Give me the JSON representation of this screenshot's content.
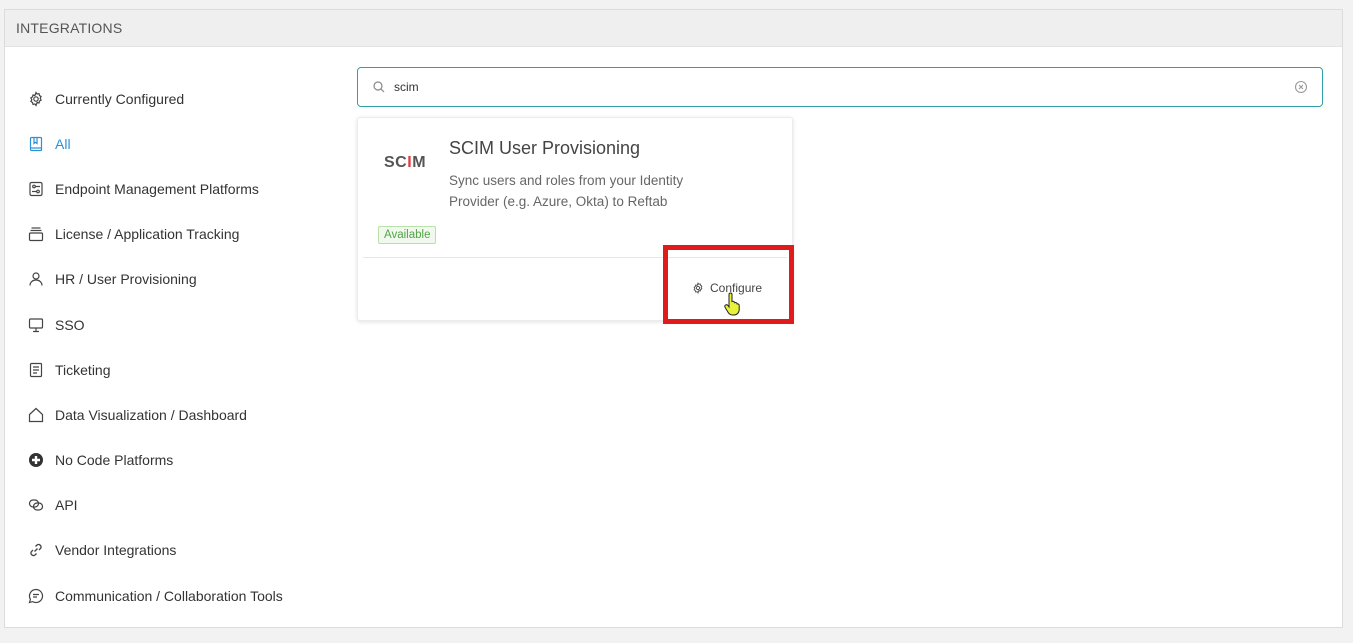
{
  "header": {
    "title": "INTEGRATIONS"
  },
  "sidebar": {
    "items": [
      {
        "label": "Currently Configured",
        "icon": "gear-icon"
      },
      {
        "label": "All",
        "icon": "book-icon",
        "active": true
      },
      {
        "label": "Endpoint Management Platforms",
        "icon": "sliders-icon"
      },
      {
        "label": "License / Application Tracking",
        "icon": "stack-icon"
      },
      {
        "label": "HR / User Provisioning",
        "icon": "user-icon"
      },
      {
        "label": "SSO",
        "icon": "monitor-icon"
      },
      {
        "label": "Ticketing",
        "icon": "document-icon"
      },
      {
        "label": "Data Visualization / Dashboard",
        "icon": "home-icon"
      },
      {
        "label": "No Code Platforms",
        "icon": "plus-circle-icon"
      },
      {
        "label": "API",
        "icon": "api-icon"
      },
      {
        "label": "Vendor Integrations",
        "icon": "link-icon"
      },
      {
        "label": "Communication / Collaboration Tools",
        "icon": "chat-icon"
      }
    ],
    "active_color": "#2d8fd5"
  },
  "search": {
    "value": "scim",
    "placeholder": ""
  },
  "card": {
    "logo_text_before": "SC",
    "logo_text_i": "I",
    "logo_text_after": "M",
    "title": "SCIM User Provisioning",
    "description": "Sync users and roles from your Identity Provider (e.g. Azure, Okta) to Reftab",
    "badge": "Available",
    "action_label": "Configure"
  },
  "colors": {
    "highlight": "#e01b1b",
    "badge_green": "#52a447",
    "search_border": "#2fa0a8"
  }
}
